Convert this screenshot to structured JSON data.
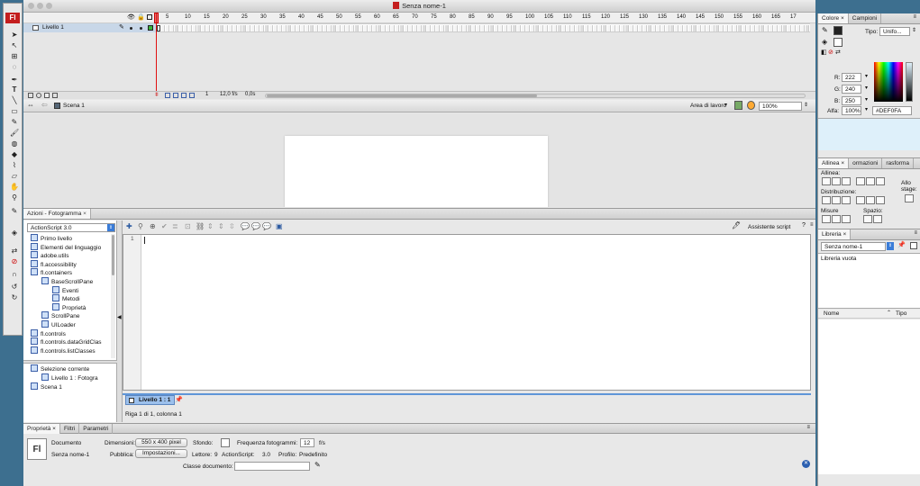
{
  "app": {
    "logo": "Fl",
    "title": "Senza nome-1"
  },
  "timeline": {
    "ticks": [
      "5",
      "10",
      "15",
      "20",
      "25",
      "30",
      "35",
      "40",
      "45",
      "50",
      "55",
      "60",
      "65",
      "70",
      "75",
      "80",
      "85",
      "90",
      "95",
      "100",
      "105",
      "110",
      "115",
      "120",
      "125",
      "130",
      "135",
      "140",
      "145",
      "150",
      "155",
      "160",
      "165",
      "17"
    ],
    "layer_name": "Livello 1",
    "frame": "1",
    "fps": "12,0 f/s",
    "time": "0,0s"
  },
  "edit_bar": {
    "scene": "Scena 1",
    "workspace": "Area di lavoro",
    "zoom": "100%"
  },
  "actions": {
    "tab": "Azioni - Fotogramma",
    "version": "ActionScript 3.0",
    "tree": [
      "Primo livello",
      "Elementi del linguaggio",
      "adobe.utils",
      "fl.accessibility",
      "fl.containers",
      "BaseScrollPane",
      "Eventi",
      "Metodi",
      "Proprietà",
      "ScrollPane",
      "UILoader",
      "fl.controls",
      "fl.controls.dataGridClas",
      "fl.controls.listClasses"
    ],
    "selection": [
      "Selezione corrente",
      "Livello 1 : Fotogra",
      "Scena 1"
    ],
    "assistant": "Assistente script",
    "line_number": "1",
    "script_tab": "Livello 1 : 1",
    "status": "Riga 1 di 1, colonna 1"
  },
  "properties": {
    "tabs": [
      "Proprietà",
      "Filtri",
      "Parametri"
    ],
    "doc_icon": "Fl",
    "doc_type": "Documento",
    "doc_name": "Senza nome-1",
    "dimensions_label": "Dimensioni:",
    "dimensions": "550 x 400 pixel",
    "bg_label": "Sfondo:",
    "fps_label": "Frequenza fotogrammi:",
    "fps": "12",
    "fps_unit": "f/s",
    "publish_label": "Pubblica:",
    "settings_btn": "Impostazioni...",
    "player_label": "Lettore:",
    "player": "9",
    "as_label": "ActionScript:",
    "as": "3.0",
    "profile_label": "Profilo:",
    "profile": "Predefinito",
    "class_label": "Classe documento:"
  },
  "color": {
    "tabs": [
      "Colore",
      "Campioni"
    ],
    "type_label": "Tipo:",
    "type": "Unifo...",
    "r_label": "R:",
    "r": "222",
    "g_label": "G:",
    "g": "240",
    "b_label": "B:",
    "b": "250",
    "alpha_label": "Alfa:",
    "alpha": "100%",
    "hex": "#DEF0FA",
    "swatch": "#def0fa"
  },
  "align": {
    "tabs": [
      "Allinea",
      "ormazioni",
      "rasforma"
    ],
    "align_label": "Allinea:",
    "dist_label": "Distribuzione:",
    "size_label": "Misure",
    "space_label": "Spazio:",
    "stage_label": "Allo stage:"
  },
  "library": {
    "tab": "Libreria",
    "doc": "Senza nome-1",
    "empty": "Libreria vuota",
    "col_name": "Nome",
    "col_type": "Tipo"
  }
}
